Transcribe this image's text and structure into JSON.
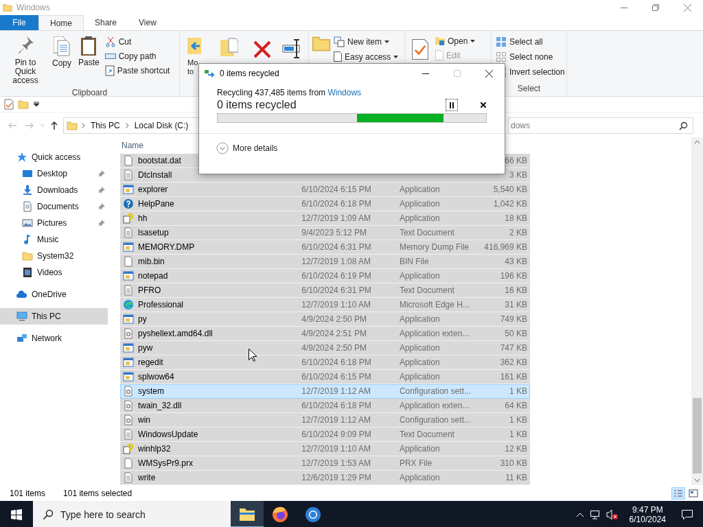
{
  "window": {
    "title": "Windows",
    "active": false
  },
  "ribbon_tabs": [
    {
      "label": "File",
      "kind": "file",
      "selected": false
    },
    {
      "label": "Home",
      "kind": "tab",
      "selected": true
    },
    {
      "label": "Share",
      "kind": "tab",
      "selected": false
    },
    {
      "label": "View",
      "kind": "tab",
      "selected": false
    }
  ],
  "clipboard": {
    "pin": "Pin to Quick access",
    "copy": "Copy",
    "paste": "Paste",
    "cut": "Cut",
    "copy_path": "Copy path",
    "paste_shortcut": "Paste shortcut",
    "group": "Clipboard"
  },
  "organize": {
    "move_to": "Mo to"
  },
  "new": {
    "new_item": "New item",
    "easy_access": "Easy access"
  },
  "open": {
    "open": "Open",
    "edit": "Edit",
    "edit_disabled": true
  },
  "select": {
    "select_all": "Select all",
    "select_none": "Select none",
    "invert": "Invert selection",
    "group": "Select"
  },
  "history": {
    "back_disabled": true,
    "forward_disabled": true
  },
  "address": {
    "path": [
      "This PC",
      "Local Disk (C:)"
    ]
  },
  "search": {
    "placeholder": "dows"
  },
  "nav": [
    {
      "label": "Quick access",
      "kind": "star",
      "pinned": false,
      "selected": false,
      "children": [
        {
          "label": "Desktop",
          "kind": "desktop",
          "pinned": true,
          "selected": false
        },
        {
          "label": "Downloads",
          "kind": "download",
          "pinned": true,
          "selected": false
        },
        {
          "label": "Documents",
          "kind": "document",
          "pinned": true,
          "selected": false
        },
        {
          "label": "Pictures",
          "kind": "picture",
          "pinned": true,
          "selected": false
        },
        {
          "label": "Music",
          "kind": "music",
          "pinned": false,
          "selected": false
        },
        {
          "label": "System32",
          "kind": "folder",
          "pinned": false,
          "selected": false
        },
        {
          "label": "Videos",
          "kind": "video",
          "pinned": false,
          "selected": false
        }
      ]
    },
    {
      "label": "OneDrive",
      "kind": "cloud",
      "pinned": false,
      "selected": false
    },
    {
      "label": "This PC",
      "kind": "computer",
      "pinned": false,
      "selected": true
    },
    {
      "label": "Network",
      "kind": "network",
      "pinned": false,
      "selected": false
    }
  ],
  "files": {
    "columns": [
      "Name"
    ],
    "rows": [
      {
        "name": "bootstat.dat",
        "size": "66 KB",
        "kind": "file",
        "selected": true,
        "focused": false
      },
      {
        "name": "DtcInstall",
        "size": "3 KB",
        "kind": "text",
        "selected": true,
        "focused": false
      },
      {
        "name": "explorer",
        "date": "6/10/2024 6:15 PM",
        "type": "Application",
        "size": "5,540 KB",
        "kind": "app",
        "selected": true,
        "focused": false
      },
      {
        "name": "HelpPane",
        "date": "6/10/2024 6:18 PM",
        "type": "Application",
        "size": "1,042 KB",
        "kind": "help",
        "selected": true,
        "focused": false
      },
      {
        "name": "hh",
        "date": "12/7/2019 1:09 AM",
        "type": "Application",
        "size": "18 KB",
        "kind": "hint",
        "selected": true,
        "focused": false
      },
      {
        "name": "lsasetup",
        "date": "9/4/2023 5:12 PM",
        "type": "Text Document",
        "size": "2 KB",
        "kind": "text",
        "selected": true,
        "focused": false
      },
      {
        "name": "MEMORY.DMP",
        "date": "6/10/2024 6:31 PM",
        "type": "Memory Dump File",
        "size": "416,969 KB",
        "kind": "app",
        "selected": true,
        "focused": false
      },
      {
        "name": "mib.bin",
        "date": "12/7/2019 1:08 AM",
        "type": "BIN File",
        "size": "43 KB",
        "kind": "file",
        "selected": true,
        "focused": false
      },
      {
        "name": "notepad",
        "date": "6/10/2024 6:19 PM",
        "type": "Application",
        "size": "196 KB",
        "kind": "app",
        "selected": true,
        "focused": false
      },
      {
        "name": "PFRO",
        "date": "6/10/2024 6:31 PM",
        "type": "Text Document",
        "size": "16 KB",
        "kind": "text",
        "selected": true,
        "focused": false
      },
      {
        "name": "Professional",
        "date": "12/7/2019 1:10 AM",
        "type": "Microsoft Edge H...",
        "size": "31 KB",
        "kind": "edge",
        "selected": true,
        "focused": false
      },
      {
        "name": "py",
        "date": "4/9/2024 2:50 PM",
        "type": "Application",
        "size": "749 KB",
        "kind": "app",
        "selected": true,
        "focused": false
      },
      {
        "name": "pyshellext.amd64.dll",
        "date": "4/9/2024 2:51 PM",
        "type": "Application exten...",
        "size": "50 KB",
        "kind": "config",
        "selected": true,
        "focused": false
      },
      {
        "name": "pyw",
        "date": "4/9/2024 2:50 PM",
        "type": "Application",
        "size": "747 KB",
        "kind": "app",
        "selected": true,
        "focused": false
      },
      {
        "name": "regedit",
        "date": "6/10/2024 6:18 PM",
        "type": "Application",
        "size": "362 KB",
        "kind": "app",
        "selected": true,
        "focused": false
      },
      {
        "name": "splwow64",
        "date": "6/10/2024 6:15 PM",
        "type": "Application",
        "size": "161 KB",
        "kind": "app",
        "selected": true,
        "focused": false
      },
      {
        "name": "system",
        "date": "12/7/2019 1:12 AM",
        "type": "Configuration sett...",
        "size": "1 KB",
        "kind": "config",
        "selected": true,
        "focused": true
      },
      {
        "name": "twain_32.dll",
        "date": "6/10/2024 6:18 PM",
        "type": "Application exten...",
        "size": "64 KB",
        "kind": "config",
        "selected": true,
        "focused": false
      },
      {
        "name": "win",
        "date": "12/7/2019 1:12 AM",
        "type": "Configuration sett...",
        "size": "1 KB",
        "kind": "config",
        "selected": true,
        "focused": false
      },
      {
        "name": "WindowsUpdate",
        "date": "6/10/2024 9:09 PM",
        "type": "Text Document",
        "size": "1 KB",
        "kind": "text",
        "selected": true,
        "focused": false
      },
      {
        "name": "winhlp32",
        "date": "12/7/2019 1:10 AM",
        "type": "Application",
        "size": "12 KB",
        "kind": "hint",
        "selected": true,
        "focused": false
      },
      {
        "name": "WMSysPr9.prx",
        "date": "12/7/2019 1:53 AM",
        "type": "PRX File",
        "size": "310 KB",
        "kind": "file",
        "selected": true,
        "focused": false
      },
      {
        "name": "write",
        "date": "12/6/2019 1:29 PM",
        "type": "Application",
        "size": "11 KB",
        "kind": "text",
        "selected": true,
        "focused": false
      }
    ]
  },
  "status_bar": {
    "count": "101 items",
    "selection": "101 items selected",
    "views": [
      {
        "kind": "details",
        "selected": true
      },
      {
        "kind": "tiles",
        "selected": false
      }
    ]
  },
  "dialog": {
    "title": "0 items recycled",
    "status": "Recycling 437,485 items from ",
    "source": "Windows",
    "headline": "0 items recycled",
    "maximize_disabled": true,
    "indeterminate": true,
    "more": "More details"
  },
  "taskbar": {
    "search_placeholder": "Type here to search",
    "apps": [
      {
        "kind": "explorer",
        "active": true
      },
      {
        "kind": "firefox",
        "active": false
      },
      {
        "kind": "chrome",
        "active": false
      }
    ],
    "volume_muted": true,
    "time": "9:47 PM",
    "date": "6/10/2024"
  }
}
